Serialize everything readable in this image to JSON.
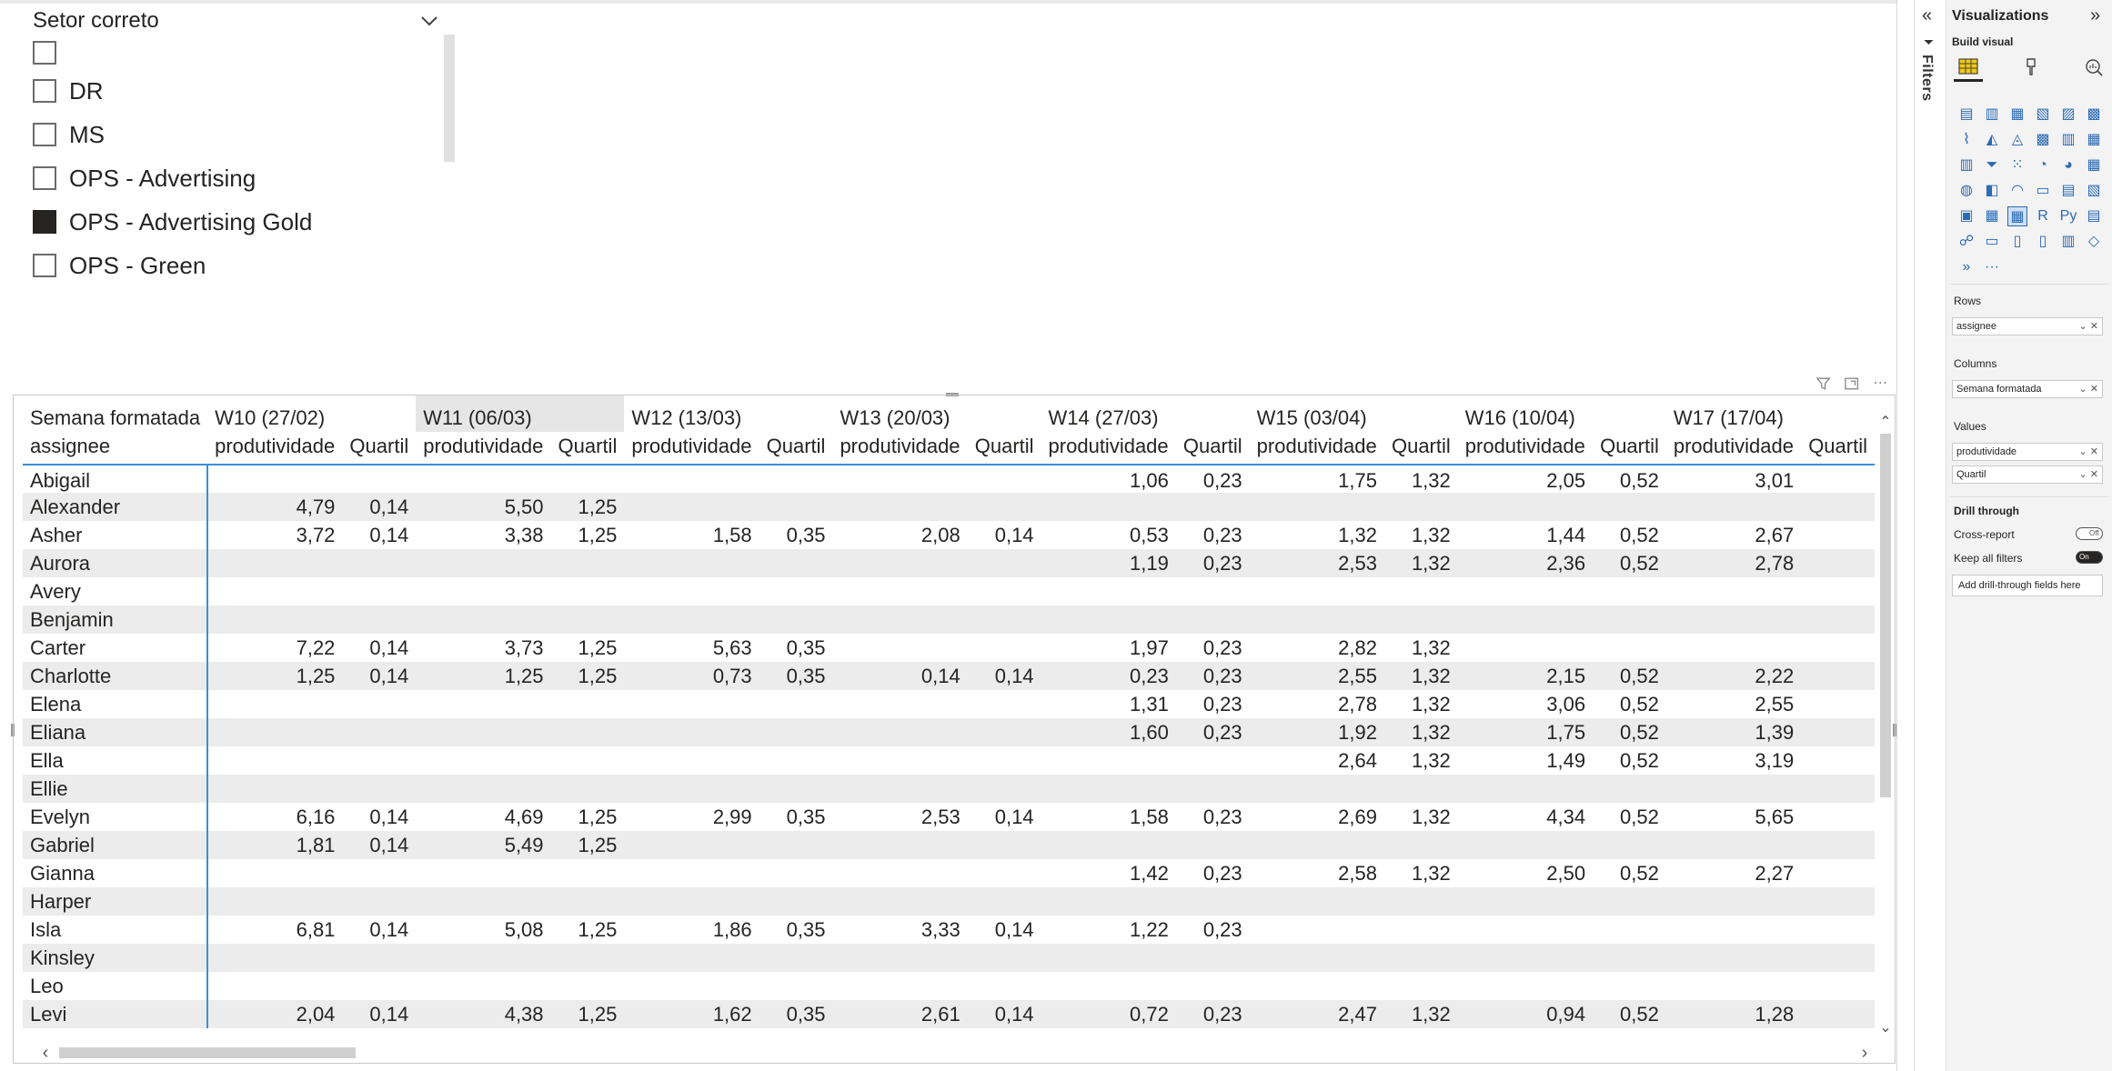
{
  "slicer": {
    "title": "Setor correto",
    "items": [
      {
        "label": "",
        "checked": false
      },
      {
        "label": "DR",
        "checked": false
      },
      {
        "label": "MS",
        "checked": false
      },
      {
        "label": "OPS - Advertising",
        "checked": false
      },
      {
        "label": "OPS - Advertising Gold",
        "checked": true
      },
      {
        "label": "OPS - Green",
        "checked": false
      }
    ]
  },
  "matrix": {
    "corner_top": "Semana formatada",
    "corner_bottom": "assignee",
    "weeks": [
      "W10 (27/02)",
      "W11 (06/03)",
      "W12 (13/03)",
      "W13 (20/03)",
      "W14 (27/03)",
      "W15 (03/04)",
      "W16 (10/04)",
      "W17 (17/04)"
    ],
    "measure_headers": [
      "produtividade",
      "Quartil"
    ],
    "rows": [
      {
        "name": "Abigail",
        "cells": [
          "",
          "",
          "",
          "",
          "",
          "",
          "",
          "",
          "1,06",
          "0,23",
          "1,75",
          "1,32",
          "2,05",
          "0,52",
          "3,01",
          ""
        ]
      },
      {
        "name": "Alexander",
        "cells": [
          "4,79",
          "0,14",
          "5,50",
          "1,25",
          "",
          "",
          "",
          "",
          "",
          "",
          "",
          "",
          "",
          "",
          "",
          ""
        ]
      },
      {
        "name": "Asher",
        "cells": [
          "3,72",
          "0,14",
          "3,38",
          "1,25",
          "1,58",
          "0,35",
          "2,08",
          "0,14",
          "0,53",
          "0,23",
          "1,32",
          "1,32",
          "1,44",
          "0,52",
          "2,67",
          ""
        ]
      },
      {
        "name": "Aurora",
        "cells": [
          "",
          "",
          "",
          "",
          "",
          "",
          "",
          "",
          "1,19",
          "0,23",
          "2,53",
          "1,32",
          "2,36",
          "0,52",
          "2,78",
          ""
        ]
      },
      {
        "name": "Avery",
        "cells": [
          "",
          "",
          "",
          "",
          "",
          "",
          "",
          "",
          "",
          "",
          "",
          "",
          "",
          "",
          "",
          ""
        ]
      },
      {
        "name": "Benjamin",
        "cells": [
          "",
          "",
          "",
          "",
          "",
          "",
          "",
          "",
          "",
          "",
          "",
          "",
          "",
          "",
          "",
          ""
        ]
      },
      {
        "name": "Carter",
        "cells": [
          "7,22",
          "0,14",
          "3,73",
          "1,25",
          "5,63",
          "0,35",
          "",
          "",
          "1,97",
          "0,23",
          "2,82",
          "1,32",
          "",
          "",
          "",
          ""
        ]
      },
      {
        "name": "Charlotte",
        "cells": [
          "1,25",
          "0,14",
          "1,25",
          "1,25",
          "0,73",
          "0,35",
          "0,14",
          "0,14",
          "0,23",
          "0,23",
          "2,55",
          "1,32",
          "2,15",
          "0,52",
          "2,22",
          ""
        ]
      },
      {
        "name": "Elena",
        "cells": [
          "",
          "",
          "",
          "",
          "",
          "",
          "",
          "",
          "1,31",
          "0,23",
          "2,78",
          "1,32",
          "3,06",
          "0,52",
          "2,55",
          ""
        ]
      },
      {
        "name": "Eliana",
        "cells": [
          "",
          "",
          "",
          "",
          "",
          "",
          "",
          "",
          "1,60",
          "0,23",
          "1,92",
          "1,32",
          "1,75",
          "0,52",
          "1,39",
          ""
        ]
      },
      {
        "name": "Ella",
        "cells": [
          "",
          "",
          "",
          "",
          "",
          "",
          "",
          "",
          "",
          "",
          "2,64",
          "1,32",
          "1,49",
          "0,52",
          "3,19",
          ""
        ]
      },
      {
        "name": "Ellie",
        "cells": [
          "",
          "",
          "",
          "",
          "",
          "",
          "",
          "",
          "",
          "",
          "",
          "",
          "",
          "",
          "",
          ""
        ]
      },
      {
        "name": "Evelyn",
        "cells": [
          "6,16",
          "0,14",
          "4,69",
          "1,25",
          "2,99",
          "0,35",
          "2,53",
          "0,14",
          "1,58",
          "0,23",
          "2,69",
          "1,32",
          "4,34",
          "0,52",
          "5,65",
          ""
        ]
      },
      {
        "name": "Gabriel",
        "cells": [
          "1,81",
          "0,14",
          "5,49",
          "1,25",
          "",
          "",
          "",
          "",
          "",
          "",
          "",
          "",
          "",
          "",
          "",
          ""
        ]
      },
      {
        "name": "Gianna",
        "cells": [
          "",
          "",
          "",
          "",
          "",
          "",
          "",
          "",
          "1,42",
          "0,23",
          "2,58",
          "1,32",
          "2,50",
          "0,52",
          "2,27",
          ""
        ]
      },
      {
        "name": "Harper",
        "cells": [
          "",
          "",
          "",
          "",
          "",
          "",
          "",
          "",
          "",
          "",
          "",
          "",
          "",
          "",
          "",
          ""
        ]
      },
      {
        "name": "Isla",
        "cells": [
          "6,81",
          "0,14",
          "5,08",
          "1,25",
          "1,86",
          "0,35",
          "3,33",
          "0,14",
          "1,22",
          "0,23",
          "",
          "",
          "",
          "",
          "",
          ""
        ]
      },
      {
        "name": "Kinsley",
        "cells": [
          "",
          "",
          "",
          "",
          "",
          "",
          "",
          "",
          "",
          "",
          "",
          "",
          "",
          "",
          "",
          ""
        ]
      },
      {
        "name": "Leo",
        "cells": [
          "",
          "",
          "",
          "",
          "",
          "",
          "",
          "",
          "",
          "",
          "",
          "",
          "",
          "",
          "",
          ""
        ]
      },
      {
        "name": "Levi",
        "cells": [
          "2,04",
          "0,14",
          "4,38",
          "1,25",
          "1,62",
          "0,35",
          "2,61",
          "0,14",
          "0,72",
          "0,23",
          "2,47",
          "1,32",
          "0,94",
          "0,52",
          "1,28",
          ""
        ]
      }
    ]
  },
  "filters_pane": {
    "label": "Filters"
  },
  "visualizations": {
    "title": "Visualizations",
    "build_visual": "Build visual",
    "more_label": "···",
    "wells": {
      "rows_label": "Rows",
      "rows_field": "assignee",
      "columns_label": "Columns",
      "columns_field": "Semana formatada",
      "values_label": "Values",
      "values_fields": [
        "produtividade",
        "Quartil"
      ]
    },
    "drill": {
      "title": "Drill through",
      "cross_report": "Cross-report",
      "cross_report_state": "Off",
      "keep_filters": "Keep all filters",
      "keep_filters_state": "On",
      "add_fields": "Add drill-through fields here"
    }
  }
}
